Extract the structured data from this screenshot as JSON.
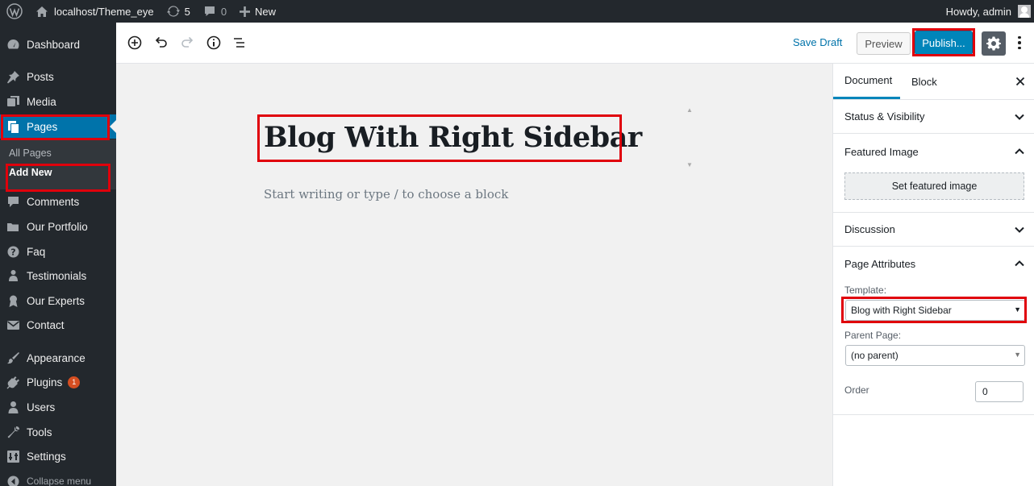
{
  "adminbar": {
    "site_name": "localhost/Theme_eye",
    "updates_count": "5",
    "comments_count": "0",
    "new_label": "New",
    "greeting": "Howdy, admin"
  },
  "sidebar": {
    "items": {
      "dashboard": "Dashboard",
      "posts": "Posts",
      "media": "Media",
      "pages": "Pages",
      "comments": "Comments",
      "our_portfolio": "Our Portfolio",
      "faq": "Faq",
      "testimonials": "Testimonials",
      "our_experts": "Our Experts",
      "contact": "Contact",
      "appearance": "Appearance",
      "plugins": "Plugins",
      "users": "Users",
      "tools": "Tools",
      "settings": "Settings"
    },
    "plugins_badge": "1",
    "submenu": {
      "all_pages": "All Pages",
      "add_new": "Add New"
    },
    "collapse_label": "Collapse menu"
  },
  "toolbar": {
    "save_draft": "Save Draft",
    "preview": "Preview",
    "publish": "Publish..."
  },
  "editor": {
    "title": "Blog With Right Sidebar",
    "placeholder": "Start writing or type / to choose a block"
  },
  "settings_sidebar": {
    "tabs": [
      "Document",
      "Block"
    ],
    "active_tab": "Document",
    "panels": {
      "status_visibility": "Status & Visibility",
      "featured_image": "Featured Image",
      "discussion": "Discussion",
      "page_attributes": "Page Attributes"
    },
    "set_featured_image": "Set featured image",
    "template_label": "Template:",
    "template_value": "Blog with Right Sidebar",
    "parent_page_label": "Parent Page:",
    "parent_page_value": "(no parent)",
    "order_label": "Order",
    "order_value": "0"
  },
  "colors": {
    "admin_dark": "#23282d",
    "admin_blue": "#0073aa",
    "publish_blue": "#0085ba",
    "highlight_red": "#e0000b"
  }
}
